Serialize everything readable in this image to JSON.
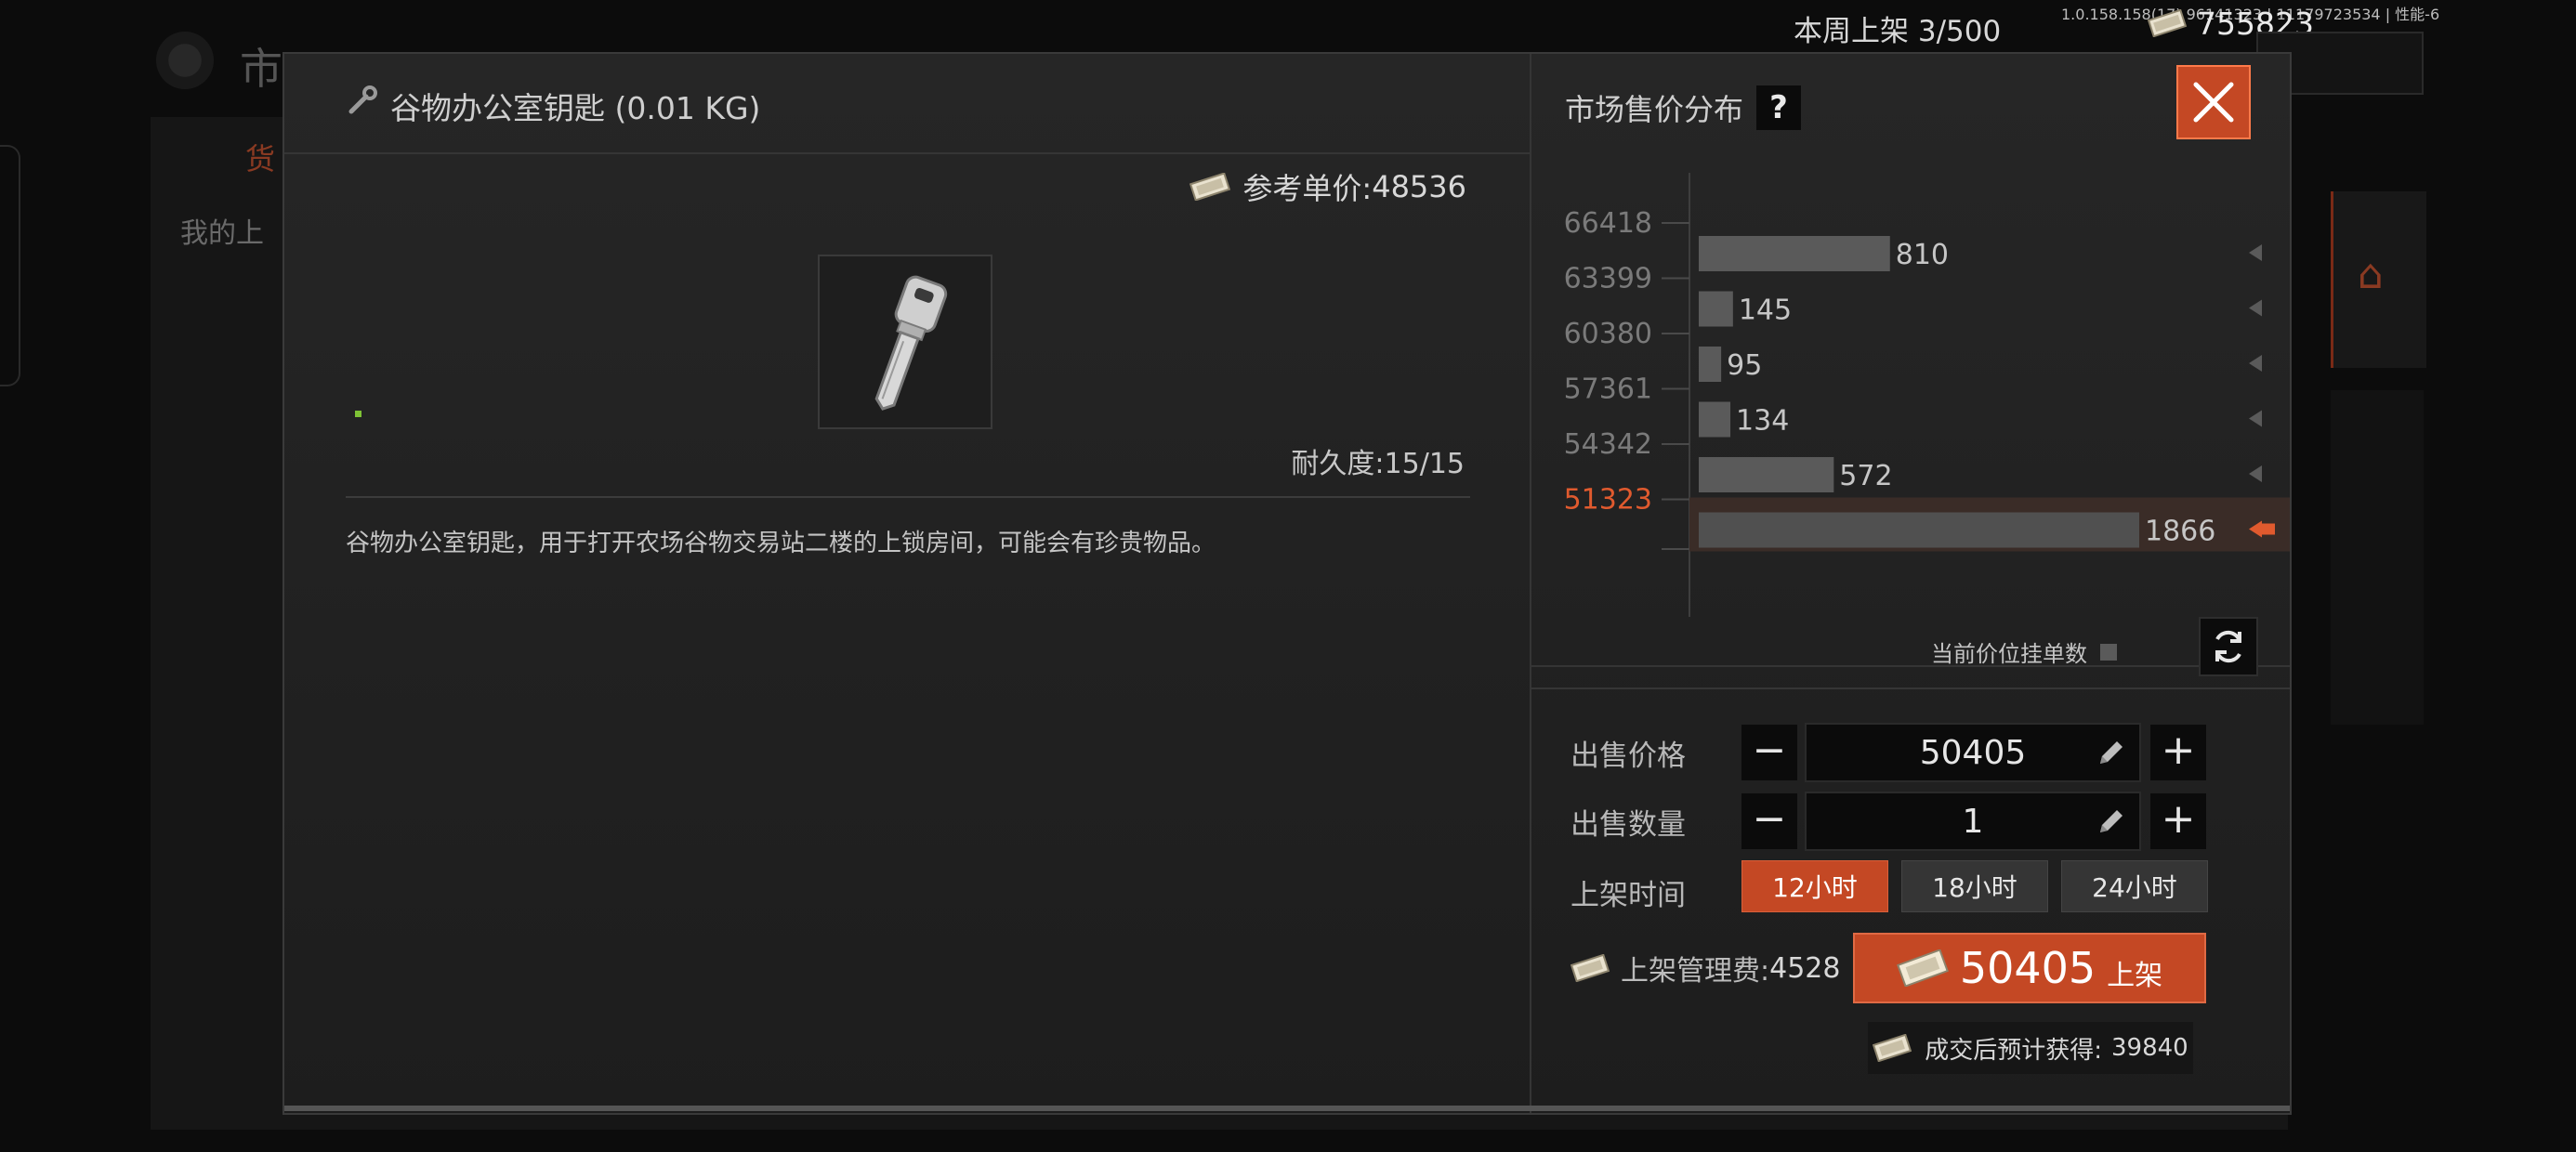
{
  "background": {
    "title": "市",
    "tab": "货",
    "my_listings": "我的上",
    "weekly_listing_label": "本周上架",
    "weekly_listing_count": "3/500",
    "version": "1.0.158.158(17) 96141323 | 11179723534 | 性能-6",
    "money": "755823"
  },
  "item": {
    "name": "谷物办公室钥匙 (0.01 KG)",
    "reference_price_label": "参考单价:",
    "reference_price": "48536",
    "durability_label": "耐久度:",
    "durability": "15/15",
    "description": "谷物办公室钥匙，用于打开农场谷物交易站二楼的上锁房间，可能会有珍贵物品。"
  },
  "market": {
    "title": "市场售价分布",
    "help": "?",
    "legend": "当前价位挂单数",
    "current_price_color": "#e05a2e"
  },
  "chart_data": {
    "type": "bar",
    "orientation": "horizontal",
    "categories": [
      "66418",
      "63399",
      "60380",
      "57361",
      "54342",
      "51323"
    ],
    "values": [
      810,
      145,
      95,
      134,
      572,
      1866
    ],
    "highlight": "51323",
    "xlim": [
      0,
      1866
    ]
  },
  "form": {
    "price_label": "出售价格",
    "price_value": "50405",
    "quantity_label": "出售数量",
    "quantity_value": "1",
    "time_label": "上架时间",
    "time_options": [
      "12小时",
      "18小时",
      "24小时"
    ],
    "time_selected": "12小时",
    "fee_label": "上架管理费:",
    "fee_value": "4528",
    "list_price": "50405",
    "list_label": "上架",
    "expected_label": "成交后预计获得:",
    "expected_value": "39840",
    "minus": "−",
    "plus": "+"
  },
  "colors": {
    "accent": "#c44824",
    "bar": "#5a5a5a",
    "highlight_text": "#e05a2e"
  }
}
